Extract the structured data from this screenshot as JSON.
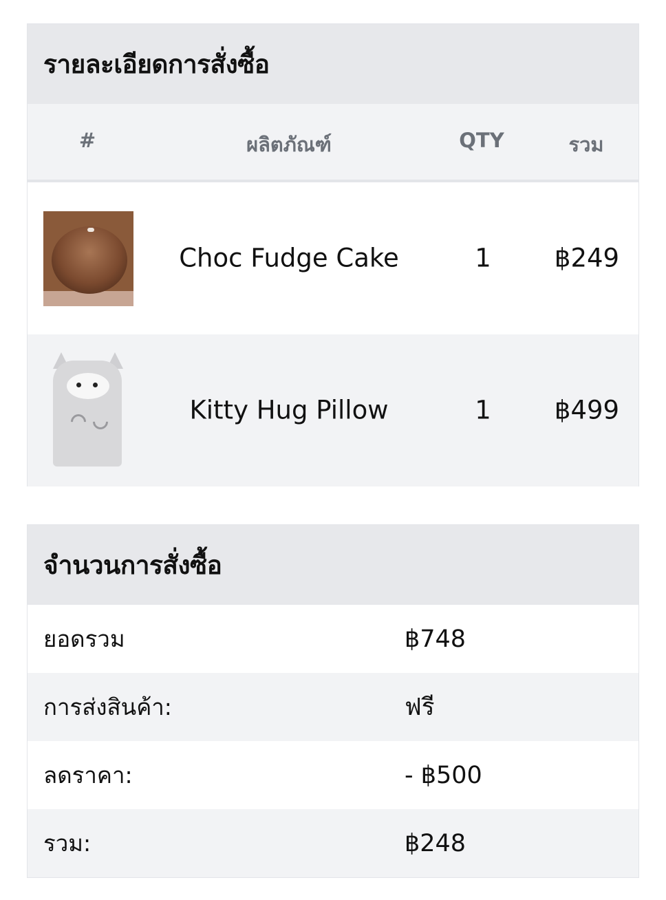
{
  "order": {
    "title": "รายละเอียดการสั่งซื้อ",
    "columns": {
      "index": "#",
      "product": "ผลิตภัณฑ์",
      "qty": "QTY",
      "total": "รวม"
    },
    "items": [
      {
        "image": "chocolate-cake-photo",
        "name": "Choc Fudge Cake",
        "qty": "1",
        "price": "฿249"
      },
      {
        "image": "kitty-pillow-photo",
        "name": "Kitty Hug Pillow",
        "qty": "1",
        "price": "฿499"
      }
    ]
  },
  "summary": {
    "title": "จำนวนการสั่งซื้อ",
    "rows": [
      {
        "label": "ยอดรวม",
        "value": "฿748"
      },
      {
        "label": "การส่งสินค้า:",
        "value": "ฟรี"
      },
      {
        "label": "ลดราคา:",
        "value": "- ฿500"
      },
      {
        "label": "รวม:",
        "value": "฿248"
      }
    ]
  }
}
